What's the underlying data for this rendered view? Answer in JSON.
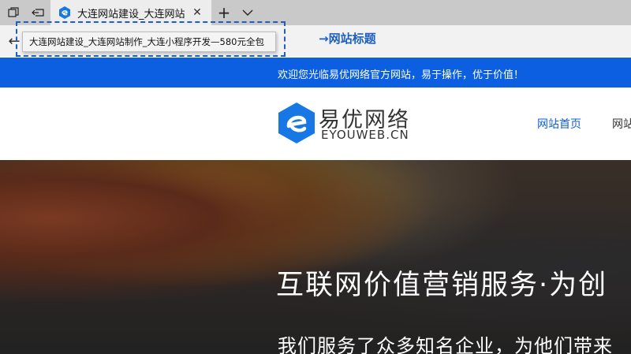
{
  "browser": {
    "tab": {
      "title": "大连网站建设_大连网站"
    },
    "tooltip": "大连网站建设_大连网站制作_大连小程序开发—580元全包",
    "annotation": "→网站标题"
  },
  "site": {
    "welcome": "欢迎您光临易优网络官方网站，易于操作，优于价值！",
    "logo": {
      "name": "易优网络",
      "sub": "EYOUWEB.CN"
    },
    "nav": [
      {
        "label": "网站首页"
      },
      {
        "label": "网站"
      }
    ],
    "hero": {
      "title": "互联网价值营销服务·为创",
      "subtitle": "我们服务了众多知名企业，为他们带来"
    }
  },
  "colors": {
    "brand": "#0b5fe0",
    "annotation": "#1f5fc2"
  }
}
